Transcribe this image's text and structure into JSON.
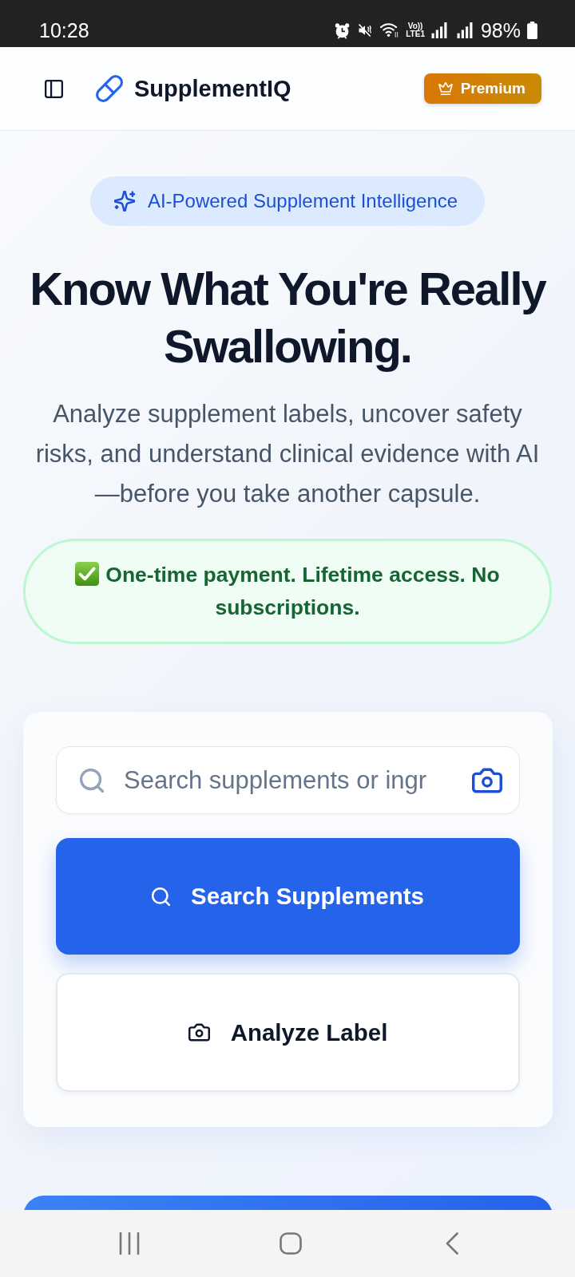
{
  "status_bar": {
    "time": "10:28",
    "network": "Vo)) LTE1",
    "battery": "98%"
  },
  "header": {
    "app_name": "SupplementIQ",
    "premium_button": "Premium"
  },
  "hero": {
    "badge": "AI-Powered Supplement Intelligence",
    "title": "Know What You're Really Swallowing.",
    "subtitle": "Analyze supplement labels, uncover safety risks, and understand clinical evidence with AI—before you take another capsule.",
    "payment_note": "One-time payment. Lifetime access. No subscriptions."
  },
  "search_card": {
    "search_field": {
      "placeholder": "Search supplements or ingr"
    },
    "buttons": [
      {
        "label": "Search Supplements",
        "kind": "primary"
      },
      {
        "label": "Analyze Label",
        "kind": "secondary"
      }
    ]
  }
}
